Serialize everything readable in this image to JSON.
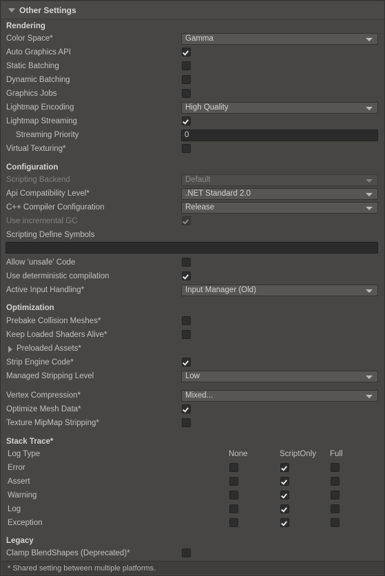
{
  "panel": {
    "header": {
      "label": "Other Settings",
      "foldout_icon": "triangle-down-icon",
      "expanded": true
    },
    "footer_note": "* Shared setting between multiple platforms."
  },
  "colors": {
    "panel_bg": "#474644",
    "header_bg": "#4b4a48",
    "dropdown_bg": "#585654",
    "field_bg": "#2b2b2b",
    "checkbox_bg": "#2d2d2d",
    "text": "#c2c2c2",
    "text_disabled": "#828180",
    "footer_bg": "#3f3e3c"
  },
  "groups": [
    {
      "id": "rendering",
      "label": "Rendering"
    },
    {
      "id": "configuration",
      "label": "Configuration"
    },
    {
      "id": "optimization",
      "label": "Optimization"
    },
    {
      "id": "stack_trace",
      "label": "Stack Trace*"
    },
    {
      "id": "legacy",
      "label": "Legacy"
    }
  ],
  "rendering": {
    "color_space": {
      "label": "Color Space*",
      "value": "Gamma"
    },
    "auto_graphics_api": {
      "label": "Auto Graphics API",
      "checked": true
    },
    "static_batching": {
      "label": "Static Batching",
      "checked": false
    },
    "dynamic_batching": {
      "label": "Dynamic Batching",
      "checked": false
    },
    "graphics_jobs": {
      "label": "Graphics Jobs",
      "checked": false
    },
    "lightmap_encoding": {
      "label": "Lightmap Encoding",
      "value": "High Quality"
    },
    "lightmap_streaming": {
      "label": "Lightmap Streaming",
      "checked": true
    },
    "streaming_priority": {
      "label": "Streaming Priority",
      "value": "0"
    },
    "virtual_texturing": {
      "label": "Virtual Texturing*",
      "checked": false
    }
  },
  "configuration": {
    "scripting_backend": {
      "label": "Scripting Backend",
      "value": "Default",
      "disabled": true
    },
    "api_compatibility_level": {
      "label": "Api Compatibility Level*",
      "value": ".NET Standard 2.0"
    },
    "cpp_compiler_configuration": {
      "label": "C++ Compiler Configuration",
      "value": "Release"
    },
    "use_incremental_gc": {
      "label": "Use incremental GC",
      "checked": true,
      "disabled": true
    },
    "scripting_define_symbols": {
      "label": "Scripting Define Symbols",
      "value": ""
    },
    "allow_unsafe_code": {
      "label": "Allow 'unsafe' Code",
      "checked": false
    },
    "use_deterministic_compilation": {
      "label": "Use deterministic compilation",
      "checked": true
    },
    "active_input_handling": {
      "label": "Active Input Handling*",
      "value": "Input Manager (Old)"
    }
  },
  "optimization": {
    "prebake_collision_meshes": {
      "label": "Prebake Collision Meshes*",
      "checked": false
    },
    "keep_loaded_shaders_alive": {
      "label": "Keep Loaded Shaders Alive*",
      "checked": false
    },
    "preloaded_assets": {
      "label": "Preloaded Assets*",
      "foldout_icon": "triangle-right-icon",
      "expanded": false
    },
    "strip_engine_code": {
      "label": "Strip Engine Code*",
      "checked": true
    },
    "managed_stripping_level": {
      "label": "Managed Stripping Level",
      "value": "Low"
    },
    "vertex_compression": {
      "label": "Vertex Compression*",
      "value": "Mixed..."
    },
    "optimize_mesh_data": {
      "label": "Optimize Mesh Data*",
      "checked": true
    },
    "texture_mipmap_stripping": {
      "label": "Texture MipMap Stripping*",
      "checked": false
    }
  },
  "stack_trace": {
    "row_label": "Log Type",
    "columns": [
      "None",
      "ScriptOnly",
      "Full"
    ],
    "rows": [
      {
        "label": "Error",
        "none": false,
        "script_only": true,
        "full": false
      },
      {
        "label": "Assert",
        "none": false,
        "script_only": true,
        "full": false
      },
      {
        "label": "Warning",
        "none": false,
        "script_only": true,
        "full": false
      },
      {
        "label": "Log",
        "none": false,
        "script_only": true,
        "full": false
      },
      {
        "label": "Exception",
        "none": false,
        "script_only": true,
        "full": false
      }
    ]
  },
  "legacy": {
    "clamp_blendshapes": {
      "label": "Clamp BlendShapes (Deprecated)*",
      "checked": false
    }
  }
}
